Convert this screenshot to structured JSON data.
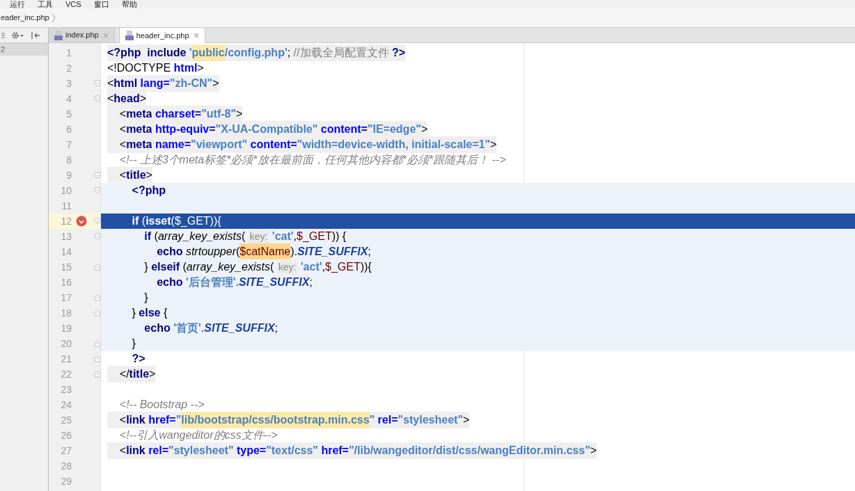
{
  "menu": [
    "运行",
    "工具",
    "VCS",
    "窗口",
    "帮助"
  ],
  "breadcrumb": "eader_inc.php",
  "project_panel": {
    "item": "2"
  },
  "tabs": [
    {
      "label": "index.php",
      "selected": false
    },
    {
      "label": "header_inc.php",
      "selected": true
    }
  ],
  "editor": {
    "lines": [
      {
        "number": "1",
        "shaded": true,
        "tokens": [
          {
            "kind": "tag",
            "text": "<?php"
          },
          {
            "kind": "kw",
            "text": "  include "
          },
          {
            "kind": "str",
            "text": "'"
          },
          {
            "kind": "str",
            "text": "public",
            "marked": true
          },
          {
            "kind": "str",
            "text": "/config.php'"
          },
          {
            "kind": "punct",
            "text": "; "
          },
          {
            "kind": "note",
            "text": "//加载全局配置文件 "
          },
          {
            "kind": "tag",
            "text": "?>"
          }
        ]
      },
      {
        "number": "2",
        "tokens": [
          {
            "kind": "punct",
            "text": "<!DOCTYPE "
          },
          {
            "kind": "attr",
            "text": "html"
          },
          {
            "kind": "punct",
            "text": ">"
          }
        ]
      },
      {
        "number": "3",
        "shaded": true,
        "fold_open": true,
        "tokens": [
          {
            "kind": "punct",
            "text": "<"
          },
          {
            "kind": "tag",
            "text": "html"
          },
          {
            "kind": "attr",
            "text": " lang="
          },
          {
            "kind": "str",
            "text": "\"zh-CN\""
          },
          {
            "kind": "punct",
            "text": ">"
          }
        ]
      },
      {
        "number": "4",
        "shaded": true,
        "fold_open": true,
        "tokens": [
          {
            "kind": "punct",
            "text": "<"
          },
          {
            "kind": "tag",
            "text": "head"
          },
          {
            "kind": "punct",
            "text": ">"
          }
        ]
      },
      {
        "number": "5",
        "shaded": true,
        "tokens": [
          {
            "kind": "punct",
            "text": "    <"
          },
          {
            "kind": "tag",
            "text": "meta"
          },
          {
            "kind": "attr",
            "text": " charset="
          },
          {
            "kind": "str",
            "text": "\"utf-8\""
          },
          {
            "kind": "punct",
            "text": ">"
          }
        ]
      },
      {
        "number": "6",
        "shaded": true,
        "tokens": [
          {
            "kind": "punct",
            "text": "    <"
          },
          {
            "kind": "tag",
            "text": "meta"
          },
          {
            "kind": "attr",
            "text": " http-equiv="
          },
          {
            "kind": "str",
            "text": "\"X-UA-Compatible\""
          },
          {
            "kind": "attr",
            "text": " content="
          },
          {
            "kind": "str",
            "text": "\"IE=edge\""
          },
          {
            "kind": "punct",
            "text": ">"
          }
        ]
      },
      {
        "number": "7",
        "shaded": true,
        "tokens": [
          {
            "kind": "punct",
            "text": "    <"
          },
          {
            "kind": "tag",
            "text": "meta"
          },
          {
            "kind": "attr",
            "text": " name="
          },
          {
            "kind": "str",
            "text": "\"viewport\""
          },
          {
            "kind": "attr",
            "text": " content="
          },
          {
            "kind": "str",
            "text": "\"width=device-width, initial-scale=1\""
          },
          {
            "kind": "punct",
            "text": ">"
          }
        ]
      },
      {
        "number": "8",
        "tokens": [
          {
            "kind": "comment",
            "text": "    <!-- 上述3个meta标签*必须*放在最前面，任何其他内容都*必须*跟随其后！ -->"
          }
        ]
      },
      {
        "number": "9",
        "shaded": true,
        "fold_open": true,
        "tokens": [
          {
            "kind": "punct",
            "text": "    <"
          },
          {
            "kind": "tag",
            "text": "title"
          },
          {
            "kind": "punct",
            "text": ">"
          }
        ]
      },
      {
        "number": "10",
        "php": true,
        "fold_open": true,
        "tokens": [
          {
            "kind": "tag",
            "text": "        <?php"
          }
        ]
      },
      {
        "number": "11",
        "php": true
      },
      {
        "number": "12",
        "php": true,
        "current": true,
        "breakpoint": true,
        "fold_open": true,
        "tokens": [
          {
            "kind": "kw",
            "text": "        if"
          },
          {
            "kind": "punct",
            "text": " ("
          },
          {
            "kind": "kw",
            "text": "isset"
          },
          {
            "kind": "punct",
            "text": "($_GET)){"
          }
        ]
      },
      {
        "number": "13",
        "php": true,
        "fold_open": true,
        "tokens": [
          {
            "kind": "kw",
            "text": "            if"
          },
          {
            "kind": "punct",
            "text": " ("
          },
          {
            "kind": "fn",
            "text": "array_key_exists"
          },
          {
            "kind": "punct",
            "text": "( "
          },
          {
            "kind": "hint",
            "text": "key:"
          },
          {
            "kind": "str",
            "text": " 'cat'"
          },
          {
            "kind": "punct",
            "text": ","
          },
          {
            "kind": "var",
            "text": "$_GET"
          },
          {
            "kind": "punct",
            "text": ")) {"
          }
        ]
      },
      {
        "number": "14",
        "php": true,
        "tokens": [
          {
            "kind": "kw",
            "text": "                echo "
          },
          {
            "kind": "fn",
            "text": "strtoupper"
          },
          {
            "kind": "punct",
            "text": "("
          },
          {
            "kind": "var",
            "text": "$catName",
            "marked": true
          },
          {
            "kind": "punct",
            "text": ")."
          },
          {
            "kind": "const",
            "text": "SITE_SUFFIX"
          },
          {
            "kind": "punct",
            "text": ";"
          }
        ]
      },
      {
        "number": "15",
        "php": true,
        "fold_close": true,
        "tokens": [
          {
            "kind": "punct",
            "text": "            } "
          },
          {
            "kind": "kw",
            "text": "elseif"
          },
          {
            "kind": "punct",
            "text": " ("
          },
          {
            "kind": "fn",
            "text": "array_key_exists"
          },
          {
            "kind": "punct",
            "text": "( "
          },
          {
            "kind": "hint",
            "text": "key:"
          },
          {
            "kind": "str",
            "text": " 'act'"
          },
          {
            "kind": "punct",
            "text": ","
          },
          {
            "kind": "var",
            "text": "$_GET"
          },
          {
            "kind": "punct",
            "text": ")){"
          }
        ]
      },
      {
        "number": "16",
        "php": true,
        "tokens": [
          {
            "kind": "kw",
            "text": "                echo "
          },
          {
            "kind": "str",
            "text": "'后台管理'"
          },
          {
            "kind": "punct",
            "text": "."
          },
          {
            "kind": "const",
            "text": "SITE_SUFFIX"
          },
          {
            "kind": "punct",
            "text": ";"
          }
        ]
      },
      {
        "number": "17",
        "php": true,
        "fold_close": true,
        "tokens": [
          {
            "kind": "punct",
            "text": "            }"
          }
        ]
      },
      {
        "number": "18",
        "php": true,
        "fold_close": true,
        "tokens": [
          {
            "kind": "punct",
            "text": "        } "
          },
          {
            "kind": "kw",
            "text": "else"
          },
          {
            "kind": "punct",
            "text": " {"
          }
        ]
      },
      {
        "number": "19",
        "php": true,
        "tokens": [
          {
            "kind": "kw",
            "text": "            echo "
          },
          {
            "kind": "str",
            "text": "'首页'"
          },
          {
            "kind": "punct",
            "text": "."
          },
          {
            "kind": "const",
            "text": "SITE_SUFFIX"
          },
          {
            "kind": "punct",
            "text": ";"
          }
        ]
      },
      {
        "number": "20",
        "php": true,
        "fold_close": true,
        "tokens": [
          {
            "kind": "punct",
            "text": "        }"
          }
        ]
      },
      {
        "number": "21",
        "fold_close": true,
        "tokens": [
          {
            "kind": "tag",
            "text": "        ?>"
          }
        ]
      },
      {
        "number": "22",
        "shaded": true,
        "fold_close": true,
        "tokens": [
          {
            "kind": "punct",
            "text": "    </"
          },
          {
            "kind": "tag",
            "text": "title"
          },
          {
            "kind": "punct",
            "text": ">"
          }
        ]
      },
      {
        "number": "23"
      },
      {
        "number": "24",
        "tokens": [
          {
            "kind": "comment",
            "text": "    <!-- Bootstrap -->"
          }
        ]
      },
      {
        "number": "25",
        "shaded": true,
        "tokens": [
          {
            "kind": "punct",
            "text": "    <"
          },
          {
            "kind": "tag",
            "text": "link"
          },
          {
            "kind": "attr",
            "text": " href="
          },
          {
            "kind": "str",
            "text": "\""
          },
          {
            "kind": "str",
            "text": "lib/bootstrap/css/bootstrap.min.css",
            "marked": true
          },
          {
            "kind": "str",
            "text": "\""
          },
          {
            "kind": "attr",
            "text": " rel="
          },
          {
            "kind": "str",
            "text": "\"stylesheet\""
          },
          {
            "kind": "punct",
            "text": ">"
          }
        ]
      },
      {
        "number": "26",
        "tokens": [
          {
            "kind": "comment",
            "text": "    <!--引入wangeditor的css文件-->"
          }
        ]
      },
      {
        "number": "27",
        "shaded": true,
        "tokens": [
          {
            "kind": "punct",
            "text": "    <"
          },
          {
            "kind": "tag",
            "text": "link"
          },
          {
            "kind": "attr",
            "text": " rel="
          },
          {
            "kind": "str",
            "text": "\"stylesheet\""
          },
          {
            "kind": "attr",
            "text": " type="
          },
          {
            "kind": "str",
            "text": "\"text/css\""
          },
          {
            "kind": "attr",
            "text": " href="
          },
          {
            "kind": "str",
            "text": "\"/lib/wangeditor/dist/css/wangEditor.min.css\""
          },
          {
            "kind": "punct",
            "text": ">"
          }
        ]
      },
      {
        "number": "28"
      },
      {
        "number": "29"
      }
    ]
  }
}
